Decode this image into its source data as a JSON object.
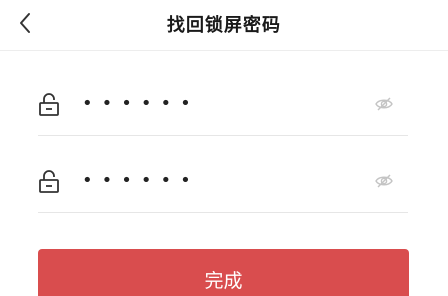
{
  "header": {
    "title": "找回锁屏密码",
    "back_icon": "chevron-left-icon"
  },
  "form": {
    "fields": [
      {
        "name": "password",
        "icon": "lock-icon",
        "masked_value": "••••••",
        "visibility_icon": "eye-off-icon"
      },
      {
        "name": "confirm-password",
        "icon": "lock-icon",
        "masked_value": "••••••",
        "visibility_icon": "eye-off-icon"
      }
    ]
  },
  "actions": {
    "done_label": "完成"
  },
  "colors": {
    "primary_button": "#d94d4e",
    "title_text": "#1a1a1a",
    "divider": "#e6e6e6",
    "icon_gray": "#c4c4c4"
  }
}
